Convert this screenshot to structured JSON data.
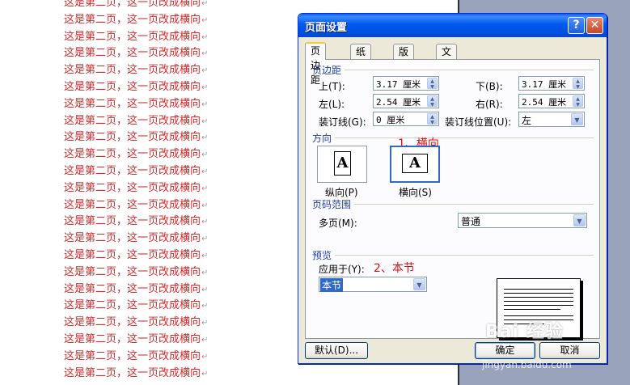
{
  "document": {
    "line_text": "这是第二页，这一页改成横向",
    "paragraph_mark": "↵",
    "line_count": 23
  },
  "dialog": {
    "title": "页面设置",
    "help_glyph": "?",
    "close_glyph": "✕",
    "tabs": [
      {
        "label": "页边距",
        "active": true
      },
      {
        "label": "纸张",
        "active": false
      },
      {
        "label": "版式",
        "active": false
      },
      {
        "label": "文档网格",
        "active": false
      }
    ],
    "margins": {
      "section_title": "页边距",
      "top_label": "上(T):",
      "top_value": "3.17 厘米",
      "bottom_label": "下(B):",
      "bottom_value": "3.17 厘米",
      "left_label": "左(L):",
      "left_value": "2.54 厘米",
      "right_label": "右(R):",
      "right_value": "2.54 厘米",
      "gutter_label": "装订线(G):",
      "gutter_value": "0 厘米",
      "gutter_pos_label": "装订线位置(U):",
      "gutter_pos_value": "左"
    },
    "orientation": {
      "section_title": "方向",
      "portrait_label": "纵向(P)",
      "landscape_label": "横向(S)",
      "glyph": "A",
      "selected": "landscape"
    },
    "pages": {
      "section_title": "页码范围",
      "multiple_label": "多页(M):",
      "multiple_value": "普通"
    },
    "preview": {
      "section_title": "预览",
      "apply_label": "应用于(Y):",
      "apply_value": "本节"
    },
    "buttons": {
      "default_label": "默认(D)...",
      "ok_label": "确定",
      "cancel_label": "取消"
    }
  },
  "annotations": {
    "step1": "1、横向",
    "step2": "2、本节"
  },
  "watermark": {
    "text": "Bai 经验",
    "sub": "jingyan.baidu.com"
  },
  "colors": {
    "doc_text": "#d42b2b",
    "title_bar": "#0058ee",
    "annotation": "#e01010",
    "selection": "#316ac5"
  }
}
